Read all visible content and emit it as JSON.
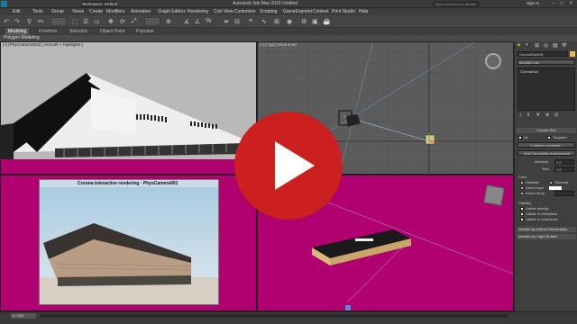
{
  "app": {
    "title": "Autodesk 3ds Max 2016    Untitled",
    "workspace": "Workspace: Default"
  },
  "search": {
    "placeholder": "Type a keyword or phrase",
    "signin": "Sign In"
  },
  "menu": [
    "Edit",
    "Tools",
    "Group",
    "Views",
    "Create",
    "Modifiers",
    "Animation",
    "Graph Editors",
    "Rendering",
    "Civil View",
    "Customize",
    "Scripting",
    "GameExporter",
    "Content",
    "Print Studio",
    "Help"
  ],
  "ribbon": {
    "tabs": [
      "Modeling",
      "Freeform",
      "Selection",
      "Object Paint",
      "Populate"
    ],
    "panel": "Polygon Modeling"
  },
  "viewports": {
    "tl": "[+] [PhysCamera001] [ Smooth + Highlights ]",
    "tr": "[+] [Top] [Wireframe]",
    "render_title": "Corona interactive rendering - PhysCamera001"
  },
  "command_panel": {
    "object_name": "CoronaSun001",
    "modifier_list": "Modifier List",
    "stack_item": "CoronaSun",
    "section_title": "Corona Sun",
    "on_label": "On",
    "targeted_label": "Targeted",
    "excluded": "0 objects excluded...",
    "add_env": "Add CoronaSky environment",
    "intensity_label": "Intensity:",
    "intensity_value": "1,0",
    "size_label": "Size:",
    "size_value": "1,0",
    "color_label": "Color",
    "realistic_label": "Realistic",
    "textured_label": "Textured",
    "direct_label": "Direct input",
    "kelvin_label": "Kelvin temp:",
    "visibility_label": "Visibility",
    "visible_directly": "Visible directly",
    "visible_reflections": "Visible in reflections",
    "visible_refractions": "Visible in refractions",
    "mr_indirect": "mental ray Indirect Illumination",
    "mr_shader": "mental ray: Light Shader"
  },
  "status": {
    "frame": "0 / 100"
  },
  "colors": {
    "accent": "#cc1f1f",
    "magenta_ground": "#a01f78",
    "grid_bg": "#5a5a5a"
  }
}
